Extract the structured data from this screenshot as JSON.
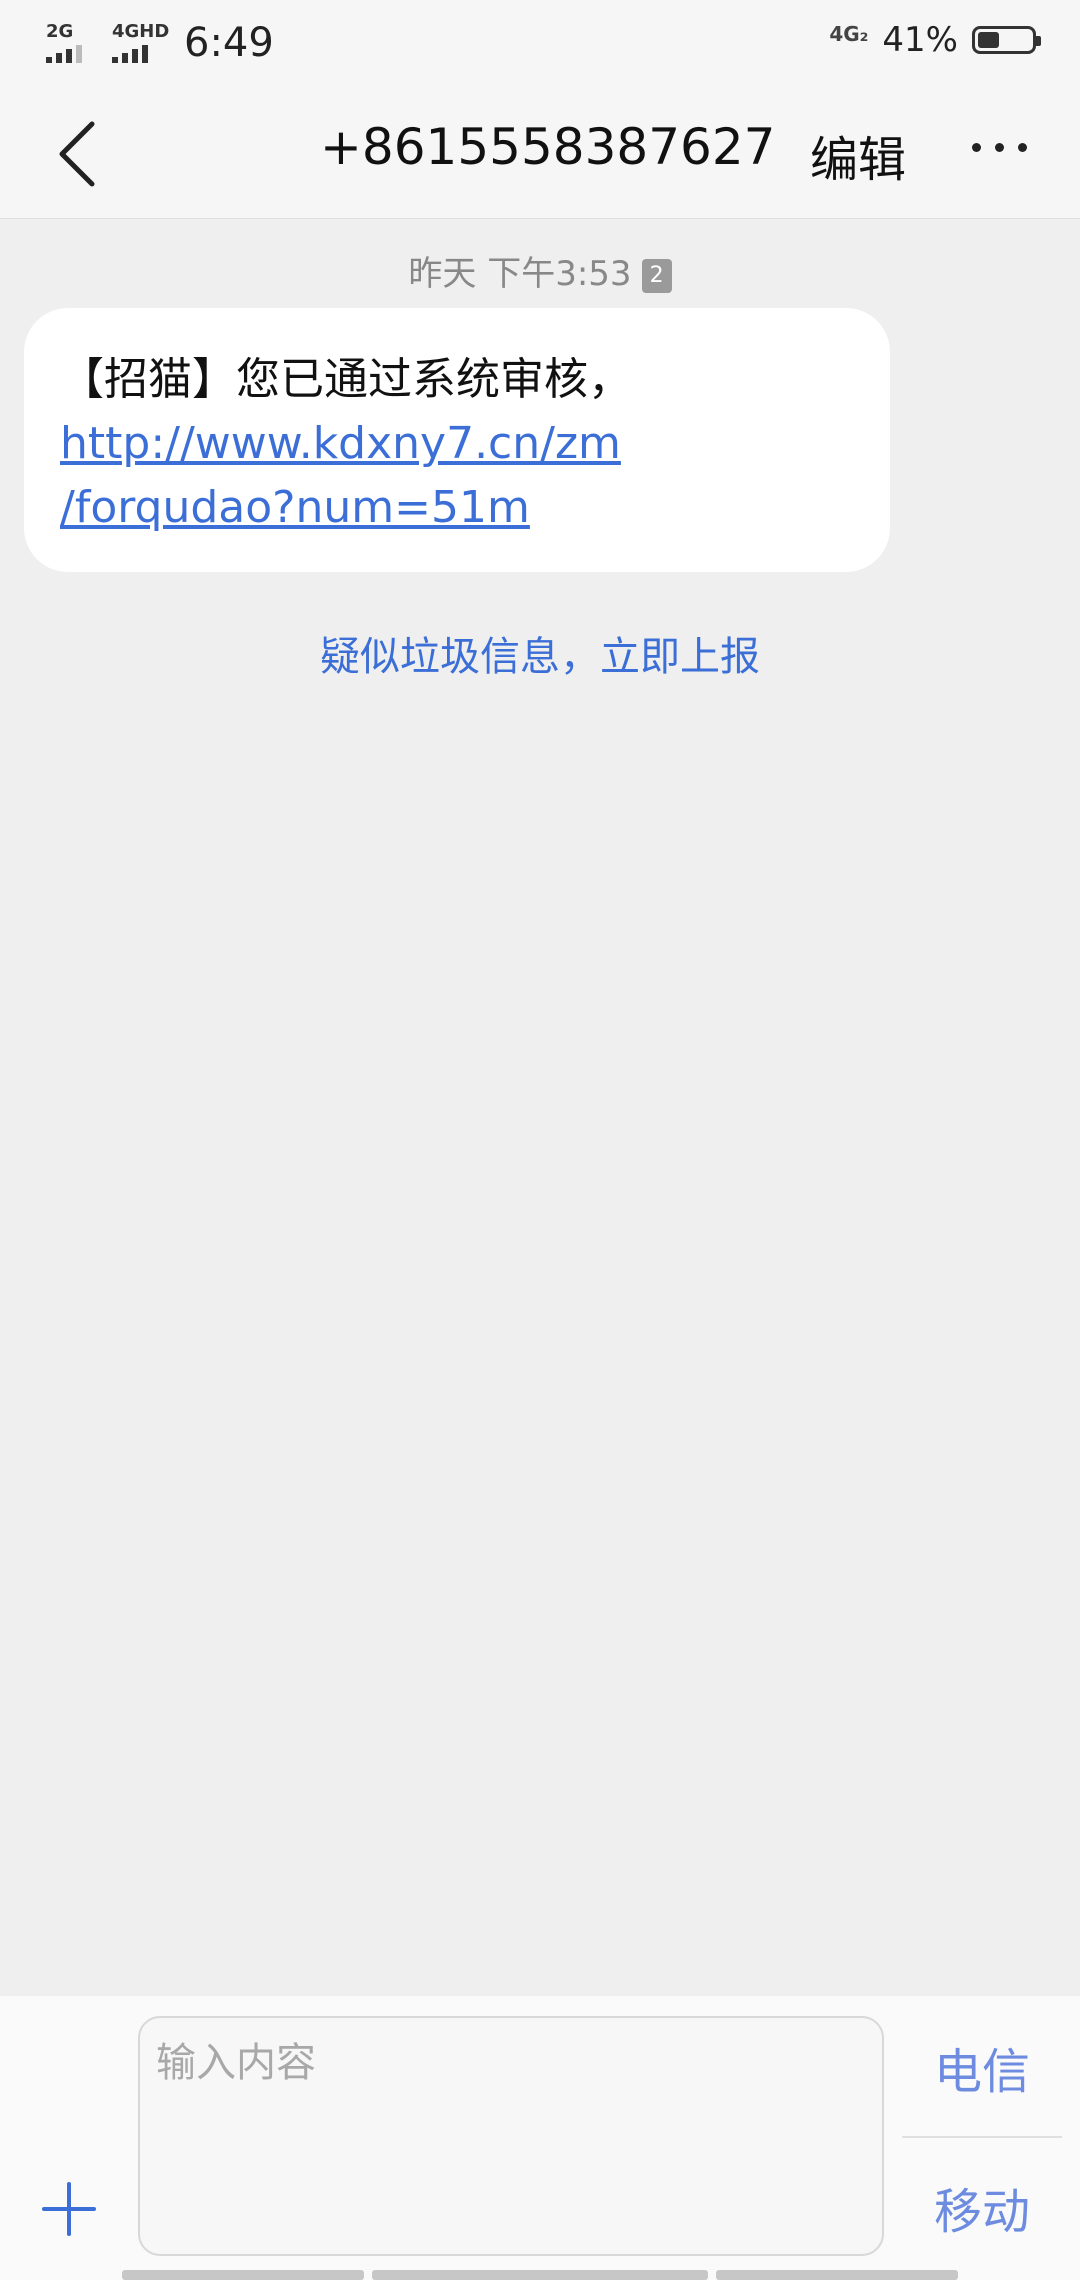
{
  "status_bar": {
    "sim1_label": "2G",
    "sim2_label": "4GHD",
    "time": "6:49",
    "network": "4G₂",
    "battery_percent": "41%",
    "battery_level": 0.41
  },
  "header": {
    "title": "+8615558387627",
    "edit_label": "编辑"
  },
  "conversation": {
    "timestamp": "昨天 下午3:53",
    "sim_badge": "2",
    "message": {
      "text": "【招猫】您已通过系统审核，",
      "link_line1": "http://www.kdxny7.cn/zm",
      "link_line2": "/forqudao?num=51m"
    },
    "spam_report": "疑似垃圾信息，立即上报"
  },
  "composer": {
    "placeholder": "输入内容",
    "sim1_send": "电信",
    "sim2_send": "移动"
  },
  "colors": {
    "accent": "#3b6ed6",
    "background": "#efefef"
  }
}
